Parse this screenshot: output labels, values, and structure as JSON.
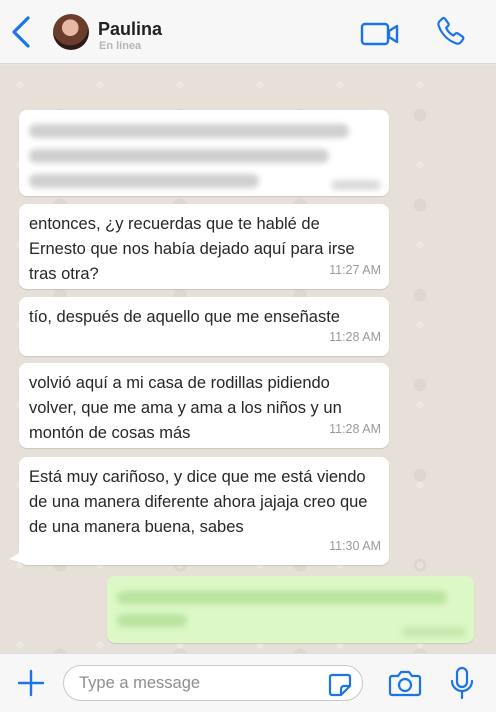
{
  "header": {
    "contact_name": "Paulina",
    "status": "En línea",
    "accent_color": "#1a73e8",
    "icons": [
      "back-icon",
      "video-call-icon",
      "phone-call-icon"
    ]
  },
  "messages": [
    {
      "direction": "incoming",
      "text": "",
      "time": "",
      "obscured": true
    },
    {
      "direction": "incoming",
      "text": "entonces, ¿y recuerdas que te hablé de Ernesto que nos había dejado aquí para irse tras otra?",
      "time": "11:27 AM"
    },
    {
      "direction": "incoming",
      "text": "tío, después de aquello que me enseñaste",
      "time": "11:28 AM"
    },
    {
      "direction": "incoming",
      "text": "volvió aquí a mi casa de rodillas pidiendo volver, que me ama y ama a los niños y un montón de cosas más",
      "time": "11:28 AM"
    },
    {
      "direction": "incoming",
      "text": "Está muy cariñoso, y dice que me está viendo de una manera diferente ahora jajaja creo que de una manera buena, sabes",
      "time": "11:30 AM"
    },
    {
      "direction": "outgoing",
      "text": "",
      "time": "",
      "obscured": true
    }
  ],
  "composer": {
    "placeholder": "Type a message",
    "icons": [
      "plus-icon",
      "sticker-icon",
      "camera-icon",
      "microphone-icon"
    ]
  }
}
